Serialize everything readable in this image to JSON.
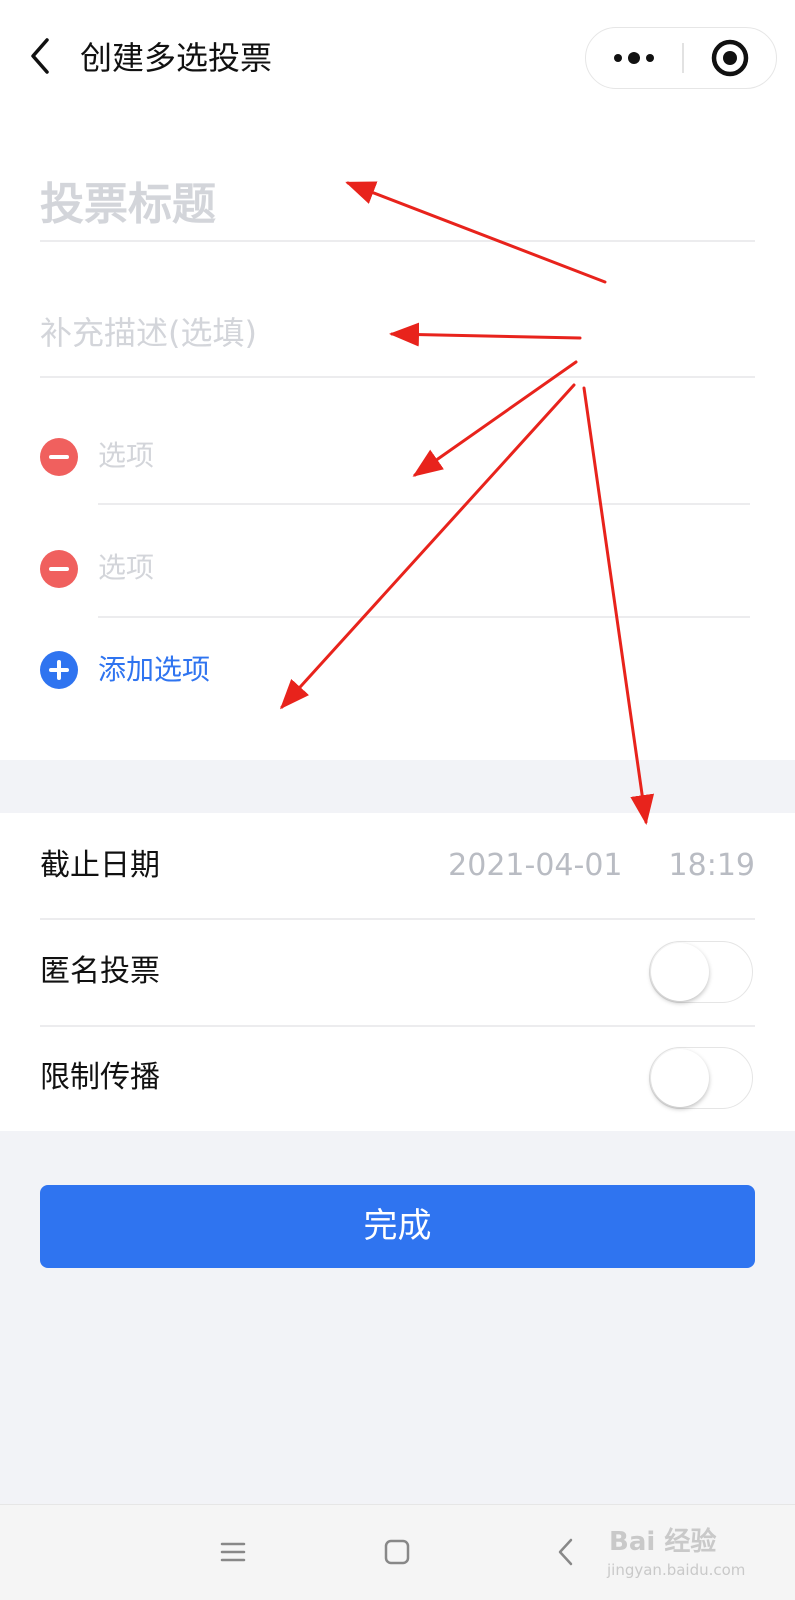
{
  "header": {
    "title": "创建多选投票",
    "back_icon": "chevron-left-icon",
    "more_icon": "more-dots-icon",
    "close_icon": "target-close-icon"
  },
  "poll": {
    "title_placeholder": "投票标题",
    "description_placeholder": "补充描述(选填)",
    "options": [
      {
        "placeholder": "选项"
      },
      {
        "placeholder": "选项"
      }
    ],
    "add_option_label": "添加选项"
  },
  "settings": {
    "deadline_label": "截止日期",
    "deadline_date": "2021-04-01",
    "deadline_time": "18:19",
    "anonymous_label": "匿名投票",
    "anonymous_on": false,
    "restrict_label": "限制传播",
    "restrict_on": false
  },
  "done_label": "完成",
  "watermark": {
    "brand": "Bai 经验",
    "url": "jingyan.baidu.com"
  },
  "colors": {
    "accent": "#2f74f0",
    "remove": "#f0605e",
    "annotation_arrow": "#e8231c",
    "placeholder": "#d3d5da",
    "page_bg": "#f2f3f7"
  }
}
